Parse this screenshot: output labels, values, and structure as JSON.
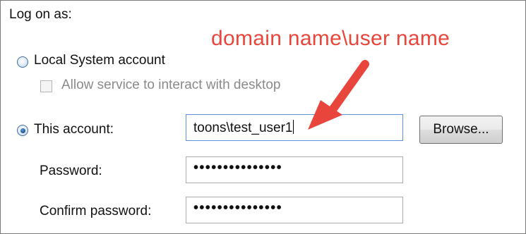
{
  "header": {
    "log_on_as": "Log on as:"
  },
  "local_system": {
    "label": "Local System account",
    "selected": false
  },
  "interact_desktop": {
    "label": "Allow service to interact with desktop",
    "checked": false,
    "enabled": false
  },
  "this_account": {
    "label": "This account:",
    "selected": true,
    "value": "toons\\test_user1",
    "browse_label": "Browse..."
  },
  "password": {
    "label": "Password:",
    "value": "•••••••••••••••"
  },
  "confirm_password": {
    "label": "Confirm password:",
    "value": "•••••••••••••••"
  },
  "annotation": {
    "text": "domain name\\user name",
    "color": "#e8463c"
  }
}
